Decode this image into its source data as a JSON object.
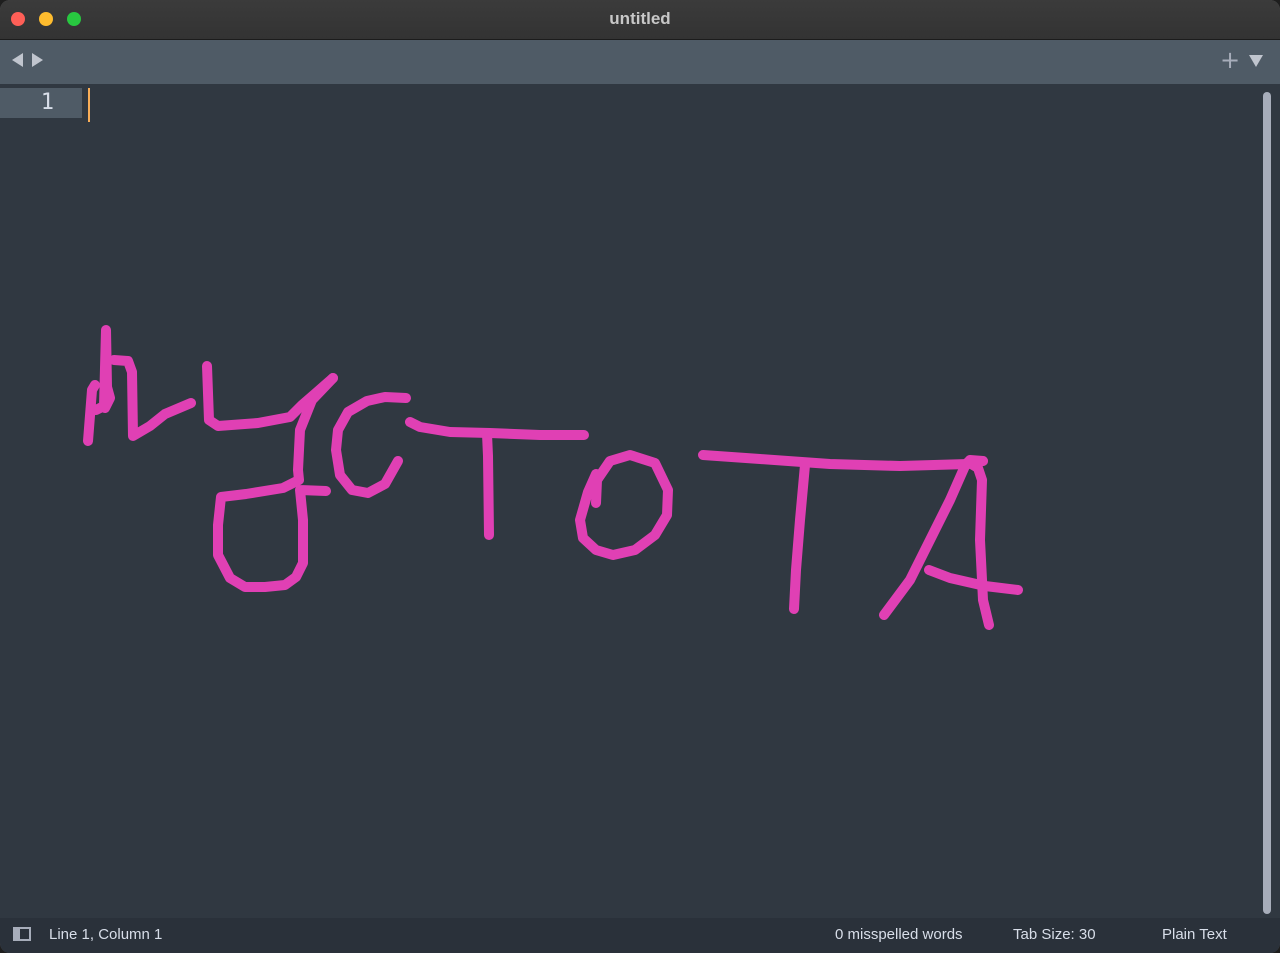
{
  "window": {
    "title": "untitled"
  },
  "editor": {
    "line_numbers": [
      "1"
    ],
    "content": ""
  },
  "statusbar": {
    "position": "Line 1, Column 1",
    "spelling": "0 misspelled words",
    "tab_size": "Tab Size: 30",
    "syntax": "Plain Text"
  },
  "colors": {
    "editor_background": "#303841",
    "line_highlight": "#4f5b66",
    "caret": "#f9ae58",
    "drawing_stroke": "#e040b4"
  },
  "icons": [
    "close-button",
    "minimize-button",
    "zoom-button",
    "back-icon",
    "forward-icon",
    "plus-icon",
    "dropdown-icon",
    "sidebar-toggle-icon"
  ]
}
